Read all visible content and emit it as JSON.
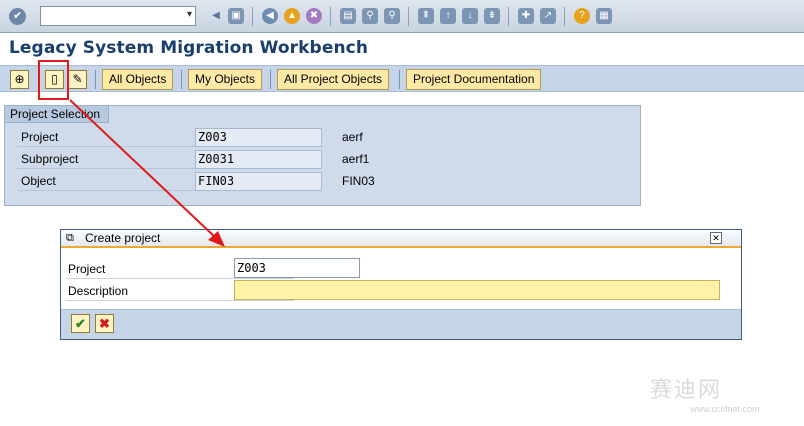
{
  "system_toolbar": {
    "command_field_value": "",
    "icons": [
      "ok-icon",
      "back-icon",
      "save-icon",
      "back-nav-icon",
      "exit-icon",
      "cancel-icon",
      "print-icon",
      "find-icon",
      "find-next-icon",
      "first-page-icon",
      "previous-page-icon",
      "next-page-icon",
      "last-page-icon",
      "new-session-icon",
      "shortcut-icon",
      "help-icon",
      "layout-icon"
    ]
  },
  "title": "Legacy System Migration Workbench",
  "app_toolbar": {
    "buttons": [
      "All Objects",
      "My Objects",
      "All Project Objects",
      "Project Documentation"
    ]
  },
  "project_selection": {
    "group_title": "Project Selection",
    "fields": [
      {
        "label": "Project",
        "value": "Z003",
        "description": "aerf"
      },
      {
        "label": "Subproject",
        "value": "Z0031",
        "description": "aerf1"
      },
      {
        "label": "Object",
        "value": "FIN03",
        "description": "FIN03"
      }
    ]
  },
  "dialog": {
    "title": "Create project",
    "project_label": "Project",
    "project_value": "Z003",
    "description_label": "Description",
    "description_value": ""
  },
  "annotation": {
    "color": "#e01a1a"
  },
  "watermark": {
    "text": "赛迪网",
    "url": "www.ccidnet.com"
  },
  "colors": {
    "title": "#1a3e6e",
    "toolbar": "#c5d4e6",
    "button": "#ffe9a6",
    "required_field": "#fff3a8"
  }
}
